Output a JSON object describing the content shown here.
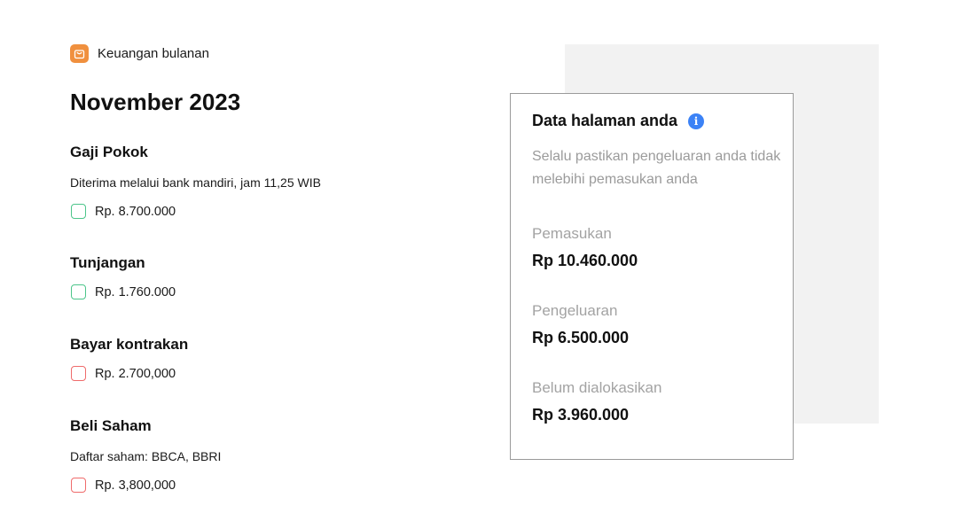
{
  "app": {
    "icon": "shopping-bag-icon",
    "title": "Keuangan bulanan",
    "accent": "#f0903e"
  },
  "month": "November 2023",
  "entries": [
    {
      "title": "Gaji Pokok",
      "description": "Diterima melalui bank mandiri, jam 11,25 WIB",
      "amount": "Rp. 8.700.000",
      "kind": "income"
    },
    {
      "title": "Tunjangan",
      "amount": "Rp. 1.760.000",
      "kind": "income"
    },
    {
      "title": "Bayar kontrakan",
      "amount": "Rp. 2.700,000",
      "kind": "expense"
    },
    {
      "title": "Beli Saham",
      "description": "Daftar saham: BBCA, BBRI",
      "amount": "Rp. 3,800,000",
      "kind": "expense"
    }
  ],
  "summary": {
    "title": "Data halaman anda",
    "info_icon": "info-icon",
    "subtitle": "Selalu pastikan pengeluaran anda tidak melebihi pemasukan anda",
    "stats": [
      {
        "label": "Pemasukan",
        "value": "Rp 10.460.000"
      },
      {
        "label": "Pengeluaran",
        "value": "Rp 6.500.000"
      },
      {
        "label": "Belum dialokasikan",
        "value": "Rp 3.960.000"
      }
    ]
  },
  "colors": {
    "income_checkbox": "#4cc58a",
    "expense_checkbox": "#ef6b6b",
    "info_icon": "#3b82f6",
    "panel_background": "#f2f2f2"
  }
}
